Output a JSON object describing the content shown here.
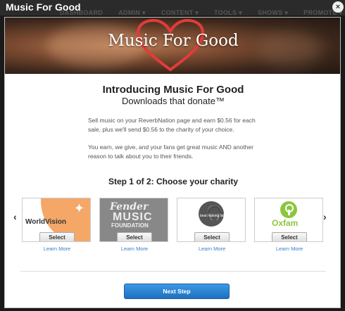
{
  "window": {
    "title": "Music For Good",
    "close_label": "×"
  },
  "background_nav": [
    "DASHBOARD",
    "ADMIN ▾",
    "CONTENT ▾",
    "TOOLS ▾",
    "SHOWS ▾",
    "PROMOTE ▾"
  ],
  "hero": {
    "title": "Music For Good",
    "heart_color": "#e23b3b"
  },
  "intro": {
    "heading": "Introducing Music For Good",
    "subheading": "Downloads that donate™",
    "paragraph1": "Sell music on your ReverbNation page and earn $0.56 for each sale, plus we'll send $0.56 to the charity of your choice.",
    "paragraph2": "You earn, we give, and your fans get great music AND another reason to talk about you to their friends."
  },
  "step": {
    "title": "Step 1 of 2: Choose your charity"
  },
  "carousel": {
    "prev_icon": "‹",
    "next_icon": "›",
    "charities": [
      {
        "logo_text": "WorldVision",
        "select_label": "Select",
        "learn_label": "Learn More"
      },
      {
        "logo_text_top": "Fender",
        "logo_text_mid": "MUSIC",
        "logo_text_bot": "FOUNDATION",
        "select_label": "Select",
        "learn_label": "Learn More"
      },
      {
        "logo_text": "beat making lab",
        "select_label": "Select",
        "learn_label": "Learn More"
      },
      {
        "logo_text": "Oxfam",
        "select_label": "Select",
        "learn_label": "Learn More"
      }
    ]
  },
  "footer": {
    "next_label": "Next Step"
  },
  "colors": {
    "accent": "#1f6fbf",
    "link": "#3a7bc8",
    "oxfam_green": "#8cc63f",
    "worldvision_orange": "#f5a767"
  }
}
